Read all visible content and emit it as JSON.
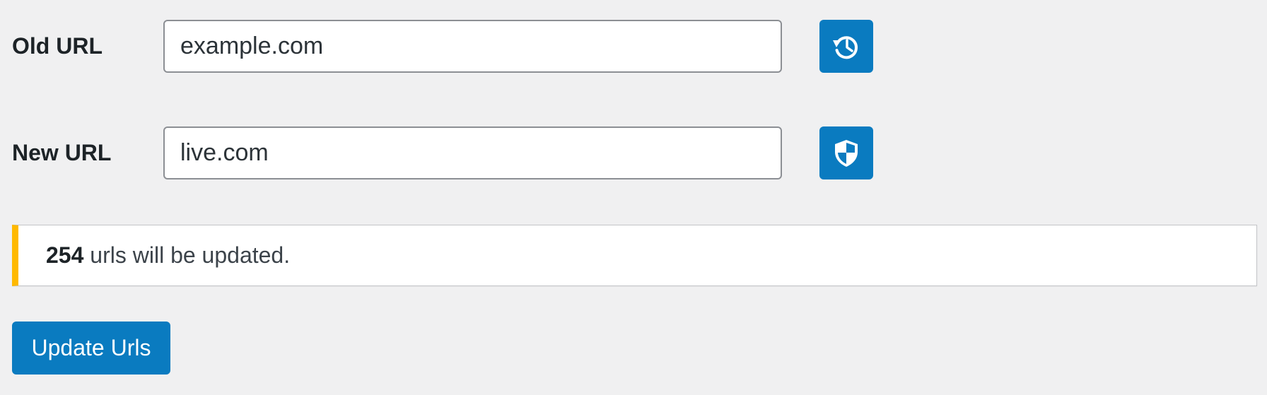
{
  "form": {
    "old_url": {
      "label": "Old URL",
      "value": "example.com",
      "button_icon": "history-icon"
    },
    "new_url": {
      "label": "New URL",
      "value": "live.com",
      "button_icon": "shield-icon"
    }
  },
  "notice": {
    "count": "254",
    "text": " urls will be updated.",
    "accent_color": "#ffb900"
  },
  "actions": {
    "update_label": "Update Urls"
  },
  "colors": {
    "primary": "#0a7bc0",
    "background": "#f0f0f1"
  }
}
